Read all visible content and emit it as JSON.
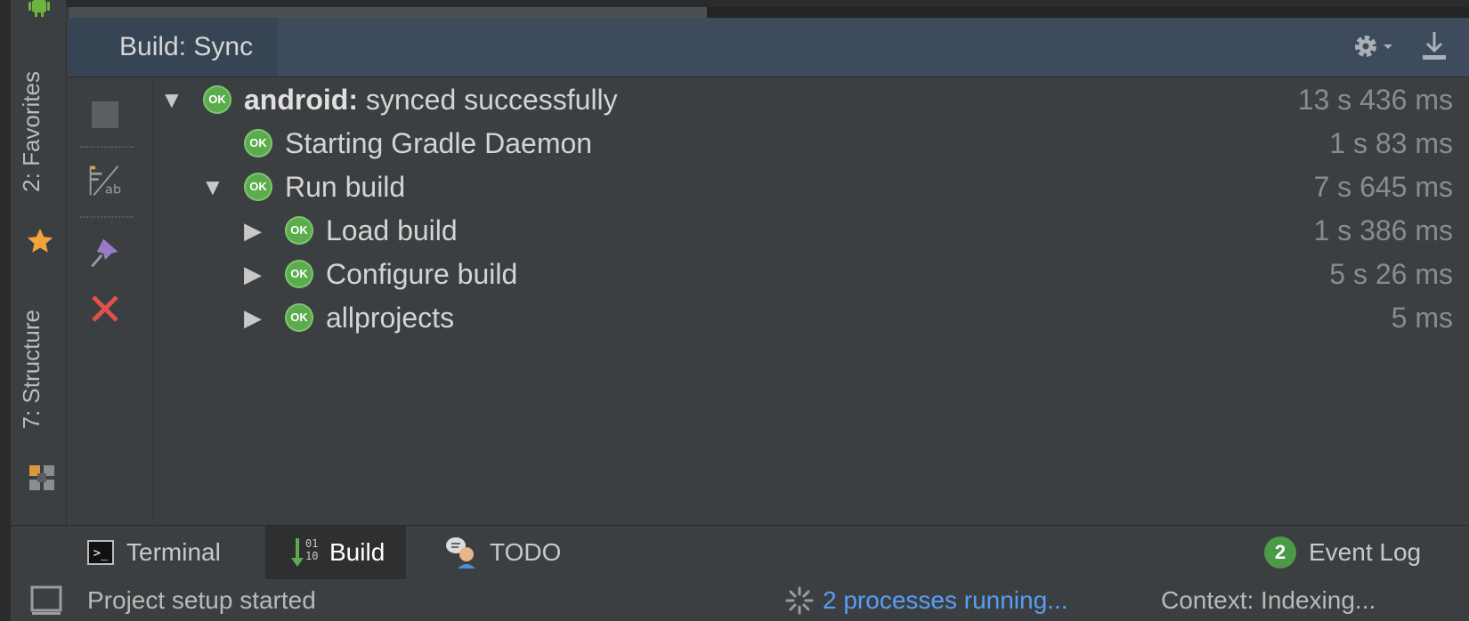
{
  "sidebar": {
    "favorites_label": "2: Favorites",
    "structure_label": "7: Structure"
  },
  "build_panel": {
    "tab_label": "Build: Sync",
    "settings_icon": "gear-icon",
    "hide_icon": "download-icon"
  },
  "toolbar_actions": {
    "stop": "stop-icon",
    "toggle_view": "toggle-view-icon",
    "pin": "pin-icon",
    "close": "close-icon"
  },
  "tree": [
    {
      "bold_label": "android:",
      "label": " synced successfully",
      "duration": "13 s 436 ms",
      "expanded": true,
      "level": 0
    },
    {
      "bold_label": "",
      "label": "Starting Gradle Daemon",
      "duration": "1 s 83 ms",
      "expanded": null,
      "level": 1
    },
    {
      "bold_label": "",
      "label": "Run build",
      "duration": "7 s 645 ms",
      "expanded": true,
      "level": 1
    },
    {
      "bold_label": "",
      "label": "Load build",
      "duration": "1 s 386 ms",
      "expanded": false,
      "level": 2
    },
    {
      "bold_label": "",
      "label": "Configure build",
      "duration": "5 s 26 ms",
      "expanded": false,
      "level": 2
    },
    {
      "bold_label": "",
      "label": "allprojects",
      "duration": "5 ms",
      "expanded": false,
      "level": 2
    }
  ],
  "ok_label": "OK",
  "tool_windows": {
    "terminal": "Terminal",
    "build": "Build",
    "build_icon_text": "01\n10",
    "todo": "TODO",
    "event_log": "Event Log",
    "event_log_count": "2"
  },
  "status_bar": {
    "message": "Project setup started",
    "processes": "2 processes running...",
    "context": "Context: Indexing..."
  },
  "colors": {
    "ok_green": "#5aac4d",
    "link_blue": "#589df6",
    "close_red": "#e0514a",
    "favorite_star": "#f0a43a",
    "pin_purple": "#9a7bc9"
  }
}
